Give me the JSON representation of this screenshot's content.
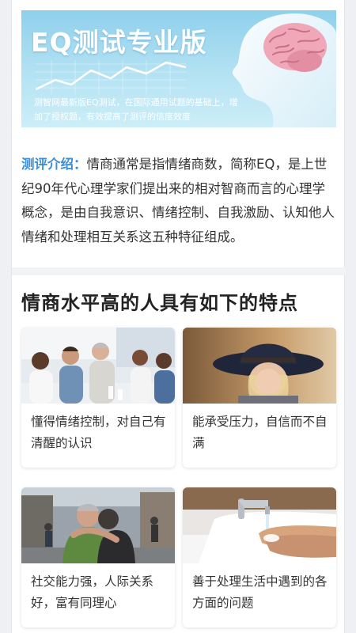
{
  "banner": {
    "title": "EQ测试专业版",
    "description": "测智网最新版EQ测试，在国际通用试题的基础上，增加了授权题，有效提高了测评的信度效度",
    "illustration_icons": [
      "line-chart-icon",
      "head-brain-icon"
    ]
  },
  "intro": {
    "label": "测评介绍：",
    "text": "情商通常是指情绪商数，简称EQ，是上世纪90年代心理学家们提出来的相对智商而言的心理学概念，是由自我意识、情绪控制、自我激励、认知他人情绪和处理相互关系这五种特征组成。"
  },
  "section": {
    "title": "情商水平高的人具有如下的特点"
  },
  "cards": [
    {
      "text": "懂得情绪控制，对自己有清醒的认识",
      "image": "meeting-photo"
    },
    {
      "text": "能承受压力，自信而不自满",
      "image": "child-hat-photo"
    },
    {
      "text": "社交能力强，人际关系好，富有同理心",
      "image": "hug-photo"
    },
    {
      "text": "善于处理生活中遇到的各方面的问题",
      "image": "washing-hands-photo"
    }
  ],
  "colors": {
    "accent": "#3d8fd6",
    "banner_bg": "#9fd8ef"
  }
}
